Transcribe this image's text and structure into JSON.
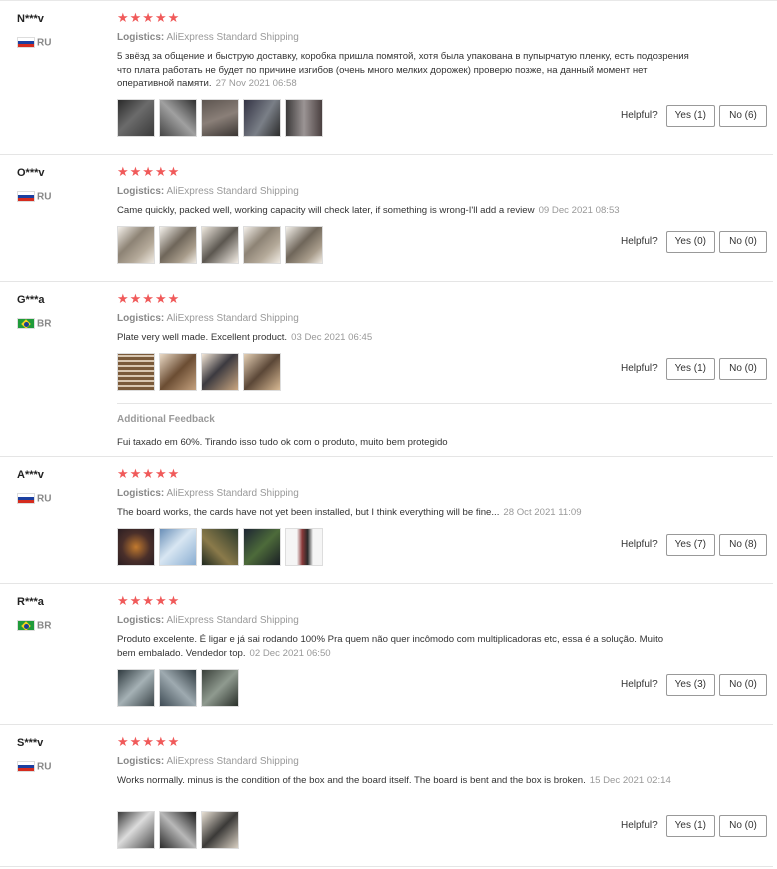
{
  "logistics_label": "Logistics:",
  "helpful_label": "Helpful?",
  "reviews": [
    {
      "user": "N***v",
      "country": "RU",
      "stars": "★★★★★",
      "shipping": "AliExpress Standard Shipping",
      "text": "5 звёзд за общение и быструю доставку, коробка пришла помятой, хотя была упакована в пупырчатую пленку, есть подозрения что плата работать не будет по причине изгибов (очень много мелких дорожек) проверю позже, на данный момент нет оперативной памяти.",
      "date": "27 Nov 2021 06:58",
      "yes": "Yes (1)",
      "no": "No (6)"
    },
    {
      "user": "O***v",
      "country": "RU",
      "stars": "★★★★★",
      "shipping": "AliExpress Standard Shipping",
      "text": "Came quickly, packed well, working capacity will check later, if something is wrong-I'll add a review",
      "date": "09 Dec 2021 08:53",
      "yes": "Yes (0)",
      "no": "No (0)"
    },
    {
      "user": "G***a",
      "country": "BR",
      "stars": "★★★★★",
      "shipping": "AliExpress Standard Shipping",
      "text": "Plate very well made. Excellent product.",
      "date": "03 Dec 2021 06:45",
      "yes": "Yes (1)",
      "no": "No (0)",
      "additional_title": "Additional Feedback",
      "additional_text": "Fui taxado em 60%. Tirando isso tudo ok com o produto, muito bem protegido"
    },
    {
      "user": "A***v",
      "country": "RU",
      "stars": "★★★★★",
      "shipping": "AliExpress Standard Shipping",
      "text": "The board works, the cards have not yet been installed, but I think everything will be fine...",
      "date": "28 Oct 2021 11:09",
      "yes": "Yes (7)",
      "no": "No (8)"
    },
    {
      "user": "R***a",
      "country": "BR",
      "stars": "★★★★★",
      "shipping": "AliExpress Standard Shipping",
      "text": "Produto excelente. É ligar e já sai rodando 100% Pra quem não quer incômodo com multiplicadoras etc, essa é a solução. Muito bem embalado. Vendedor top.",
      "date": "02 Dec 2021 06:50",
      "yes": "Yes (3)",
      "no": "No (0)"
    },
    {
      "user": "S***v",
      "country": "RU",
      "stars": "★★★★★",
      "shipping": "AliExpress Standard Shipping",
      "text": "Works normally. minus is the condition of the box and the board itself. The board is bent and the box is broken.",
      "date": "15 Dec 2021 02:14",
      "yes": "Yes (1)",
      "no": "No (0)"
    }
  ],
  "colors": {
    "star": "#f05a5a",
    "muted_text": "#999999",
    "divider": "#e5e5e5"
  }
}
